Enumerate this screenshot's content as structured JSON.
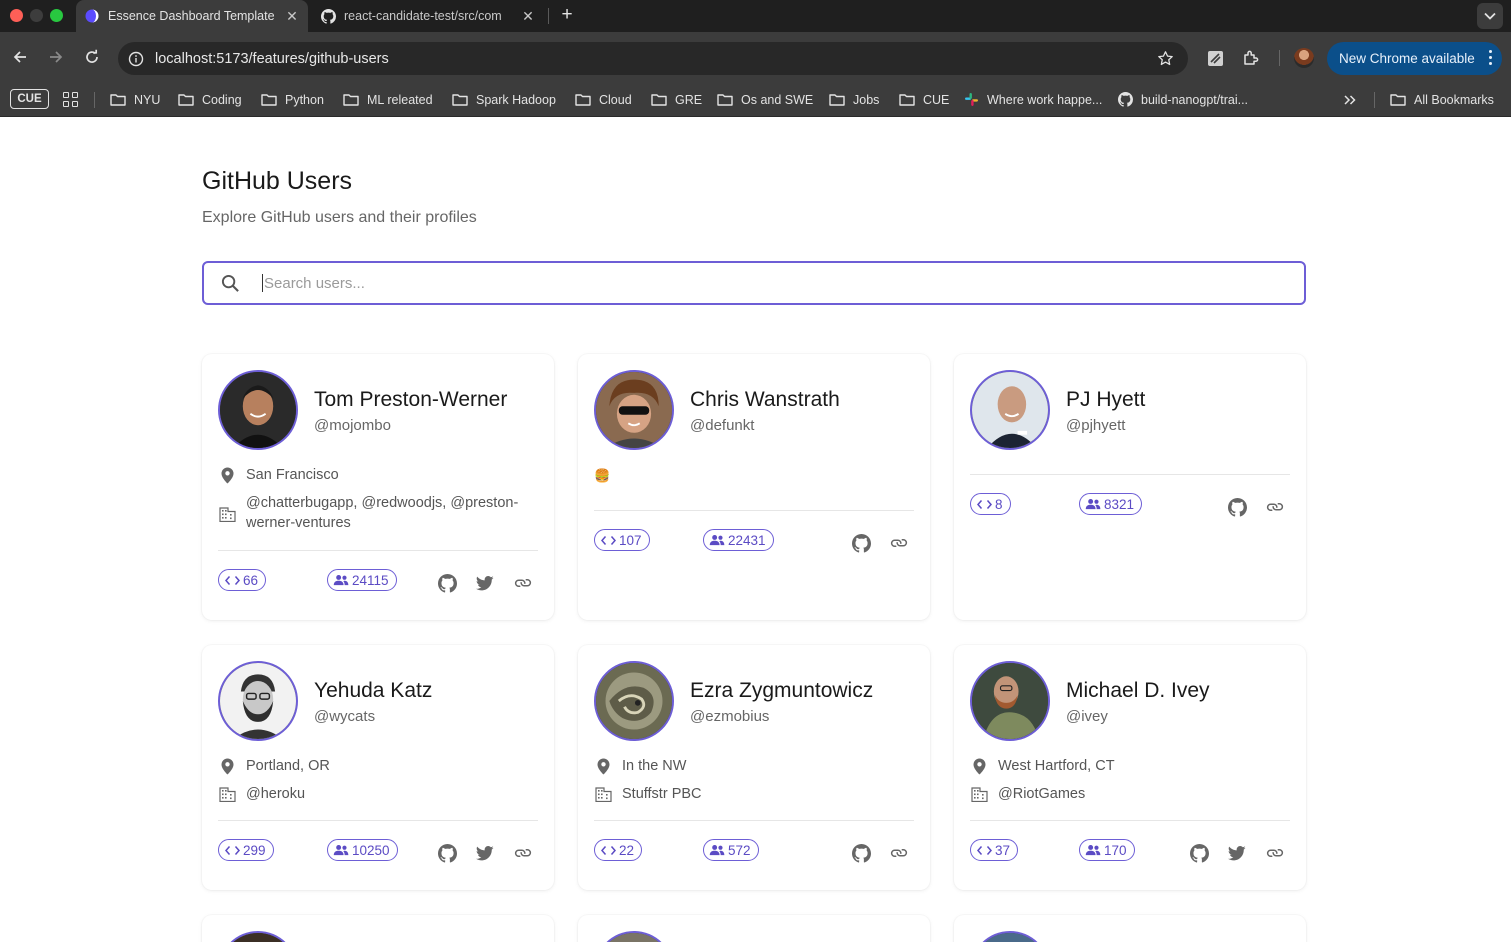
{
  "browser": {
    "tabs": [
      {
        "title": "Essence Dashboard Template",
        "active": true
      },
      {
        "title": "react-candidate-test/src/com",
        "active": false
      }
    ],
    "url": "localhost:5173/features/github-users",
    "update_button": "New Chrome available",
    "bookmarks": {
      "cue_badge": "CUE",
      "items": [
        "NYU",
        "Coding",
        "Python",
        "ML releated",
        "Spark Hadoop",
        "Cloud",
        "GRE",
        "Os and SWE",
        "Jobs",
        "CUE",
        "Where work happe...",
        "build-nanogpt/trai..."
      ],
      "all_bookmarks": "All Bookmarks"
    }
  },
  "page": {
    "title": "GitHub Users",
    "subtitle": "Explore GitHub users and their profiles",
    "search_placeholder": "Search users...",
    "accent_color": "#6d5ed6"
  },
  "users": [
    {
      "name": "Tom Preston-Werner",
      "login": "@mojombo",
      "location": "San Francisco",
      "company": "@chatterbugapp, @redwoodjs, @preston-werner-ventures",
      "repos": "66",
      "followers": "24115",
      "twitter": true
    },
    {
      "name": "Chris Wanstrath",
      "login": "@defunkt",
      "bio": "🍔",
      "repos": "107",
      "followers": "22431",
      "twitter": false
    },
    {
      "name": "PJ Hyett",
      "login": "@pjhyett",
      "repos": "8",
      "followers": "8321",
      "twitter": false
    },
    {
      "name": "Yehuda Katz",
      "login": "@wycats",
      "location": "Portland, OR",
      "company": "@heroku",
      "repos": "299",
      "followers": "10250",
      "twitter": true
    },
    {
      "name": "Ezra Zygmuntowicz",
      "login": "@ezmobius",
      "location": "In the NW",
      "company": "Stuffstr PBC",
      "repos": "22",
      "followers": "572",
      "twitter": false
    },
    {
      "name": "Michael D. Ivey",
      "login": "@ivey",
      "location": "West Hartford, CT",
      "company": "@RiotGames",
      "repos": "37",
      "followers": "170",
      "twitter": true
    }
  ]
}
